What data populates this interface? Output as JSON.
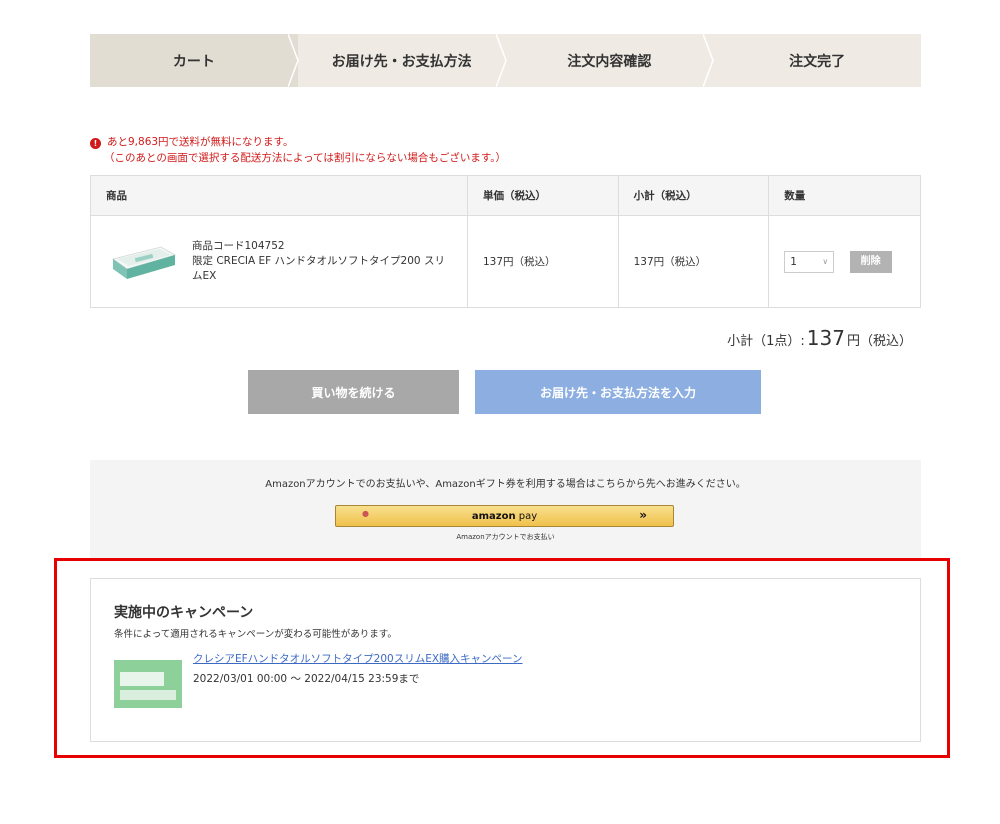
{
  "steps": [
    {
      "label": "カート",
      "active": true
    },
    {
      "label": "お届け先・お支払方法",
      "active": false
    },
    {
      "label": "注文内容確認",
      "active": false
    },
    {
      "label": "注文完了",
      "active": false
    }
  ],
  "notice": {
    "line1": "あと9,863円で送料が無料になります。",
    "line2": "（このあとの画面で選択する配送方法によっては割引にならない場合もございます。）"
  },
  "table": {
    "headers": {
      "item": "商品",
      "price": "単価（税込）",
      "subtotal": "小計（税込）",
      "qty": "数量"
    },
    "rows": [
      {
        "code": "商品コード104752",
        "name": "限定 CRECIA EF ハンドタオルソフトタイプ200 スリムEX",
        "price": "137円（税込）",
        "subtotal": "137円（税込）",
        "qty": "1",
        "delete_label": "削除"
      }
    ]
  },
  "summary": {
    "label": "小計（1点）:",
    "amount": "137",
    "unit": "円（税込）"
  },
  "buttons": {
    "continue_label": "買い物を続ける",
    "next_label": "お届け先・お支払方法を入力"
  },
  "amazon": {
    "text": "Amazonアカウントでのお支払いや、Amazonギフト券を利用する場合はこちらから先へお進みください。",
    "button_logo_main": "amazon",
    "button_logo_sub": " pay",
    "button_arrow": "»",
    "sub_text": "Amazonアカウントでお支払い"
  },
  "campaign": {
    "title": "実施中のキャンペーン",
    "description": "条件によって適用されるキャンペーンが変わる可能性があります。",
    "link_text": "クレシアEFハンドタオルソフトタイプ200スリムEX購入キャンペーン",
    "period": "2022/03/01 00:00 ～ 2022/04/15 23:59まで"
  },
  "colors": {
    "accent_red": "#e60000",
    "notice_red": "#d21a1a",
    "next_button": "#8caee0",
    "continue_button": "#a8a8a8",
    "link": "#3d6bc4"
  }
}
